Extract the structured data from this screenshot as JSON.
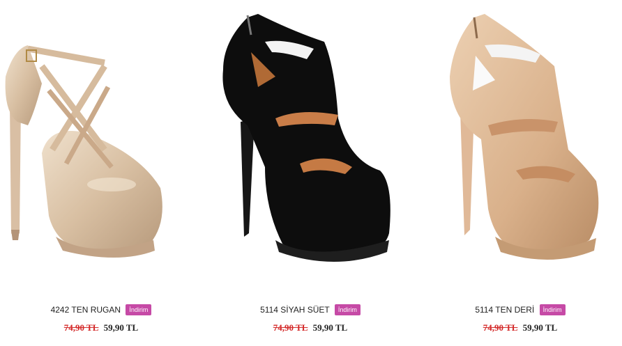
{
  "products": [
    {
      "name": "4242 TEN RUGAN",
      "badge": "İndirim",
      "old_price": "74,90 TL",
      "price": "59,90 TL",
      "image": "nude-patent-platform-heel"
    },
    {
      "name": "5114 SİYAH SÜET",
      "badge": "İndirim",
      "old_price": "74,90 TL",
      "price": "59,90 TL",
      "image": "black-suede-cutout-platform-heel"
    },
    {
      "name": "5114 TEN DERİ",
      "badge": "İndirim",
      "old_price": "74,90 TL",
      "price": "59,90 TL",
      "image": "nude-leather-cutout-platform-heel"
    }
  ],
  "colors": {
    "badge_bg": "#c64aa6",
    "old_price": "#d42a2a",
    "text": "#222222",
    "nude_patent": "#dcc4a8",
    "black_suede": "#0d0d0d",
    "nude_leather": "#e2bd98"
  }
}
